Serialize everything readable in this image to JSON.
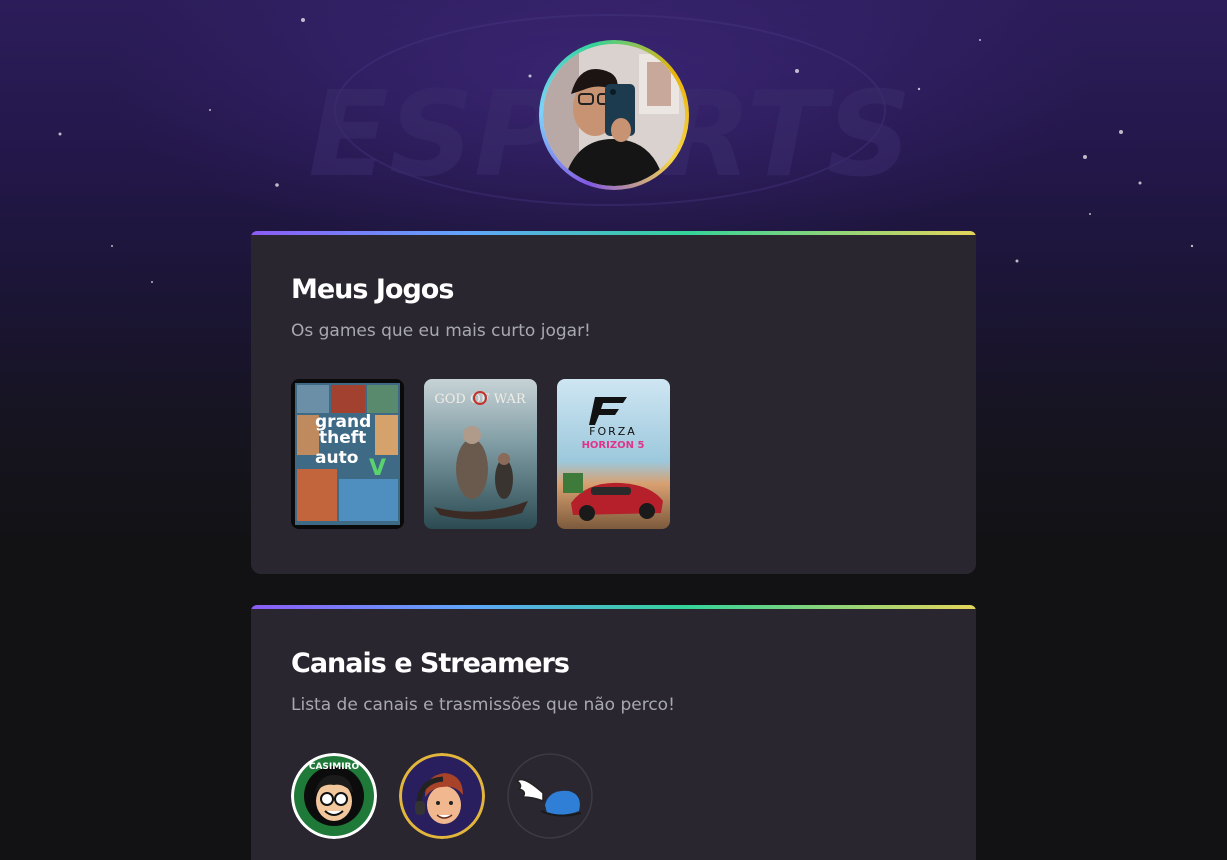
{
  "profile": {
    "avatar_alt": "profile-photo"
  },
  "background": {
    "watermark_text": "ESPORTS"
  },
  "games_card": {
    "title": "Meus Jogos",
    "subtitle": "Os games que eu mais curto jogar!",
    "games": [
      {
        "name": "GTA V",
        "cover_lines": [
          "grand",
          "theft",
          "auto"
        ],
        "badge": "V"
      },
      {
        "name": "God of War",
        "cover_title": "GOD OF WAR"
      },
      {
        "name": "Forza Horizon 5",
        "cover_title": "FORZA",
        "cover_sub": "HORIZON 5"
      }
    ]
  },
  "streamers_card": {
    "title": "Canais e Streamers",
    "subtitle": "Lista de canais e trasmissões que não perco!",
    "streamers": [
      {
        "name": "Casimiro",
        "ring_text": "CASIMIRO"
      },
      {
        "name": "streamer-2"
      },
      {
        "name": "streamer-3"
      }
    ]
  },
  "colors": {
    "accent_gradient": [
      "#8b5cf6",
      "#60a5fa",
      "#34d399",
      "#e5d45a"
    ],
    "card_bg": "#29262f",
    "page_bg": "#121214",
    "subtitle": "#a8a8b3"
  }
}
